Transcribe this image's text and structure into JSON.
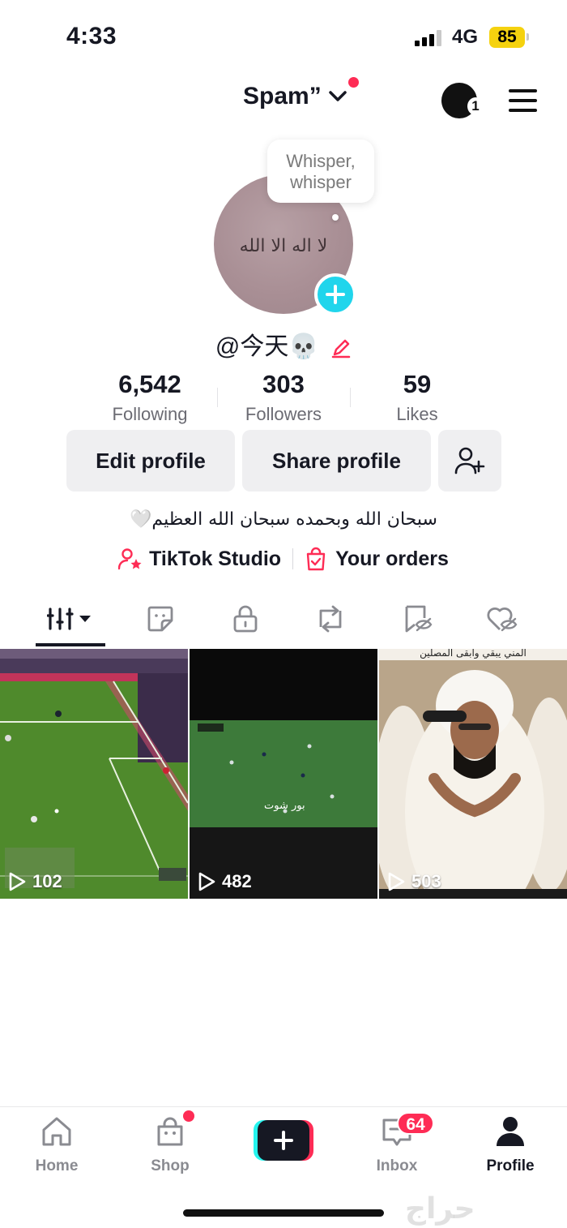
{
  "status": {
    "time": "4:33",
    "network": "4G",
    "battery": "85"
  },
  "header": {
    "title": "Spam”",
    "account_badge": "1"
  },
  "profile": {
    "bubble_text": "Whisper, whisper",
    "avatar_text": "لا اله الا الله",
    "username": "@今天💀",
    "stats": [
      {
        "value": "6,542",
        "label": "Following"
      },
      {
        "value": "303",
        "label": "Followers"
      },
      {
        "value": "59",
        "label": "Likes"
      }
    ],
    "edit_label": "Edit profile",
    "share_label": "Share profile",
    "bio": "سبحان الله وبحمده سبحان الله العظيم🤍",
    "studio_label": "TikTok Studio",
    "orders_label": "Your orders"
  },
  "tabs": [
    "videos-tab",
    "stickers-tab",
    "private-tab",
    "reposts-tab",
    "favorites-tab",
    "liked-tab"
  ],
  "videos": [
    {
      "views": "102"
    },
    {
      "views": "482",
      "overlay": "بور شوت"
    },
    {
      "views": "503",
      "caption": "المني يبقي وابقى المصلين"
    }
  ],
  "nav": {
    "home": "Home",
    "shop": "Shop",
    "inbox": "Inbox",
    "inbox_badge": "64",
    "profile": "Profile"
  },
  "watermark": "حراج",
  "colors": {
    "accent": "#fe2c55",
    "cyan": "#20d5ec",
    "battery": "#f5d20f"
  }
}
